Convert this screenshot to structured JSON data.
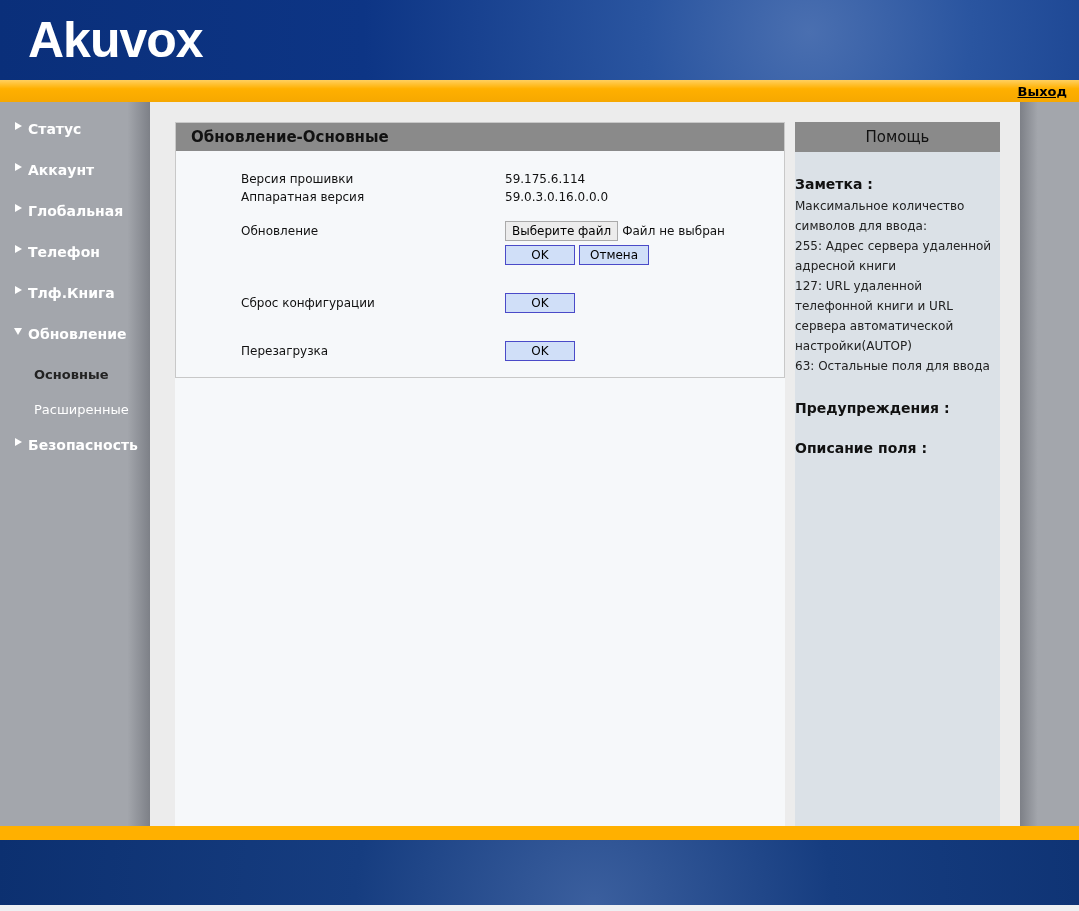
{
  "logo": "Akuvox",
  "logout": "Выход",
  "sidebar": {
    "items": [
      {
        "label": "Статус",
        "expanded": false
      },
      {
        "label": "Аккаунт",
        "expanded": false
      },
      {
        "label": "Глобальная",
        "expanded": false
      },
      {
        "label": "Телефон",
        "expanded": false
      },
      {
        "label": "Тлф.Книга",
        "expanded": false
      },
      {
        "label": "Обновление",
        "expanded": true,
        "children": [
          {
            "label": "Основные",
            "selected": true
          },
          {
            "label": "Расширенные",
            "selected": false
          }
        ]
      },
      {
        "label": "Безопасность",
        "expanded": false
      }
    ]
  },
  "panel": {
    "title": "Обновление-Основные",
    "rows": [
      {
        "kind": "info",
        "label": "Версия прошивки",
        "value": "59.175.6.114"
      },
      {
        "kind": "info",
        "label": "Аппаратная версия",
        "value": "59.0.3.0.16.0.0.0"
      },
      {
        "kind": "file",
        "label": "Обновление",
        "button": "Выберите файл",
        "status": "Файл не выбран",
        "actions": [
          "OK",
          "Отмена"
        ]
      },
      {
        "kind": "action",
        "label": "Сброс конфигурации",
        "button": "OK"
      },
      {
        "kind": "action",
        "label": "Перезагрузка",
        "button": "OK"
      }
    ]
  },
  "help": {
    "title": "Помощь",
    "sections": [
      {
        "heading": "Заметка :",
        "lines": [
          "Максимальное количество символов для ввода:",
          "255: Адрес сервера удаленной адресной книги",
          "127: URL удаленной телефонной книги и URL сервера автоматической настройки(AUTOP)",
          "63: Остальные поля для ввода"
        ]
      },
      {
        "heading": "Предупреждения :"
      },
      {
        "heading": "Описание поля :"
      }
    ]
  }
}
